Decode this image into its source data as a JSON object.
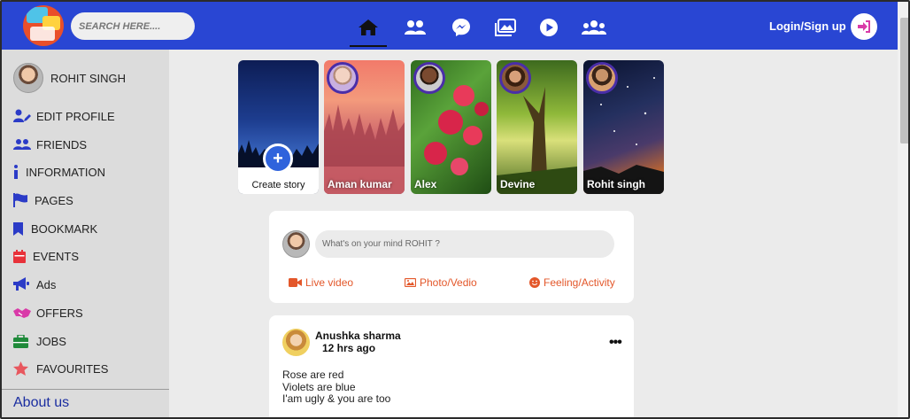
{
  "header": {
    "search_placeholder": "SEARCH HERE....",
    "nav": [
      {
        "icon": "home-icon",
        "active": true
      },
      {
        "icon": "friends-icon"
      },
      {
        "icon": "messenger-icon"
      },
      {
        "icon": "photos-icon"
      },
      {
        "icon": "video-play-icon"
      },
      {
        "icon": "groups-icon"
      }
    ],
    "login_label": "Login/Sign up",
    "login_icon": "sign-in-icon",
    "brand_color": "#2946d3"
  },
  "sidebar": {
    "profile_name": "ROHIT SINGH",
    "items": [
      {
        "label": "EDIT PROFILE",
        "icon": "user-edit-icon",
        "color": "#2b3bc7"
      },
      {
        "label": "FRIENDS",
        "icon": "friends-icon",
        "color": "#2b3bc7"
      },
      {
        "label": "INFORMATION",
        "icon": "info-icon",
        "color": "#2b3bc7"
      },
      {
        "label": "PAGES",
        "icon": "flag-icon",
        "color": "#2b3bc7"
      },
      {
        "label": "BOOKMARK",
        "icon": "bookmark-icon",
        "color": "#2b3bc7"
      },
      {
        "label": "EVENTS",
        "icon": "calendar-icon",
        "color": "#e8323a"
      },
      {
        "label": "Ads",
        "icon": "megaphone-icon",
        "color": "#2b3bc7"
      },
      {
        "label": "OFFERS",
        "icon": "handshake-icon",
        "color": "#d93aa8"
      },
      {
        "label": "JOBS",
        "icon": "briefcase-icon",
        "color": "#1f8a3a"
      },
      {
        "label": "FAVOURITES",
        "icon": "star-icon",
        "color": "#e8575e"
      }
    ],
    "about_label": "About us"
  },
  "stories": {
    "create_label": "Create story",
    "items": [
      {
        "name": "Aman kumar"
      },
      {
        "name": "Alex"
      },
      {
        "name": "Devine"
      },
      {
        "name": "Rohit singh"
      }
    ]
  },
  "composer": {
    "placeholder": "What's on your mind ROHIT ?",
    "actions": [
      {
        "label": "Live video",
        "icon": "video-camera-icon"
      },
      {
        "label": "Photo/Vedio",
        "icon": "image-icon"
      },
      {
        "label": "Feeling/Activity",
        "icon": "smile-icon"
      }
    ],
    "accent_color": "#e3572a"
  },
  "post": {
    "author": "Anushka sharma",
    "time": "12 hrs ago",
    "menu": "•••",
    "lines": [
      "Rose are red",
      "Violets are blue",
      "I'am ugly & you are too"
    ]
  }
}
